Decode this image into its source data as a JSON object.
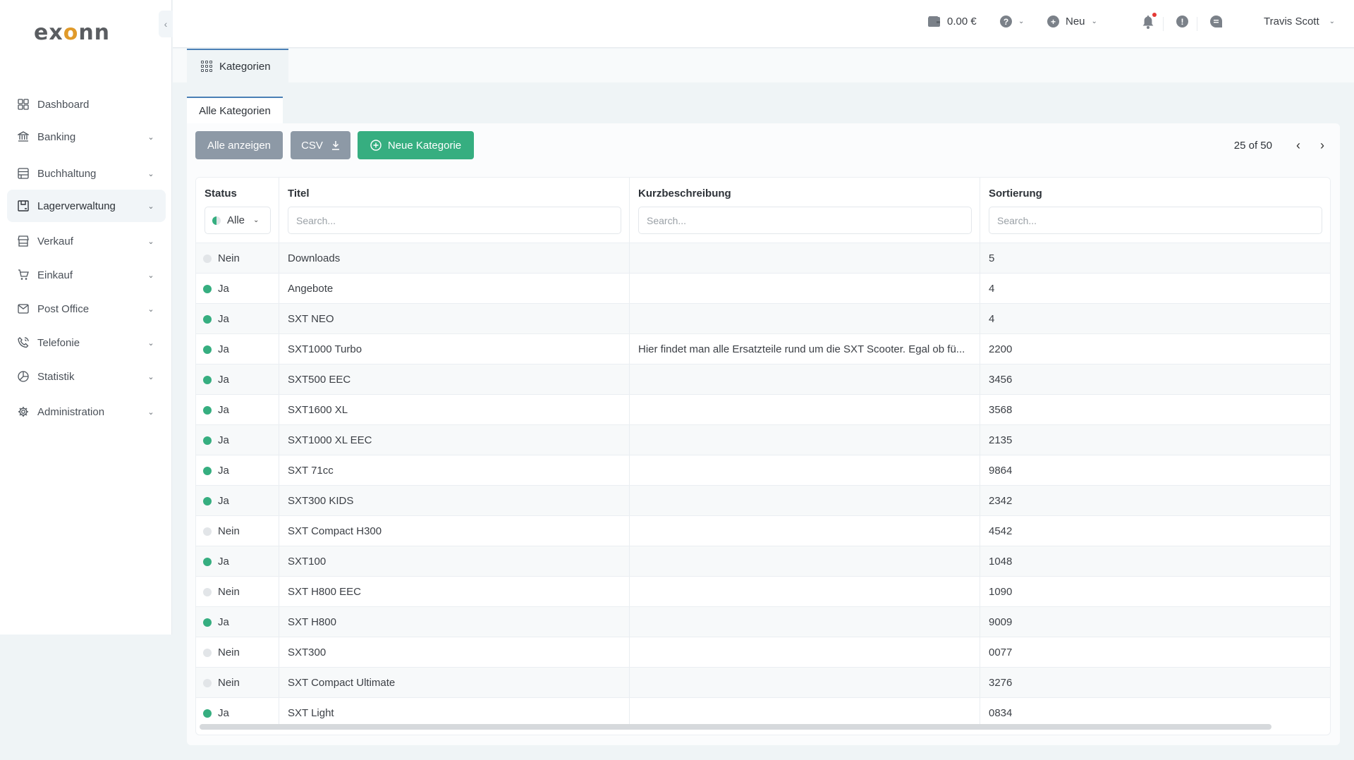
{
  "brand": {
    "name_prefix": "ex",
    "name_o": "o",
    "name_suffix": "nn"
  },
  "sidebar": {
    "collapse_icon": "‹",
    "items": [
      {
        "label": "Dashboard",
        "icon": "dashboard-grid-icon",
        "has_chevron": false,
        "active": false
      },
      {
        "label": "Banking",
        "icon": "bank-icon",
        "has_chevron": true,
        "active": false
      },
      {
        "label": "Buchhaltung",
        "icon": "ledger-icon",
        "has_chevron": true,
        "active": false
      },
      {
        "label": "Lagerverwaltung",
        "icon": "warehouse-box-icon",
        "has_chevron": true,
        "active": true
      },
      {
        "label": "Verkauf",
        "icon": "store-icon",
        "has_chevron": true,
        "active": false
      },
      {
        "label": "Einkauf",
        "icon": "cart-icon",
        "has_chevron": true,
        "active": false
      },
      {
        "label": "Post Office",
        "icon": "mail-icon",
        "has_chevron": true,
        "active": false
      },
      {
        "label": "Telefonie",
        "icon": "phone-icon",
        "has_chevron": true,
        "active": false
      },
      {
        "label": "Statistik",
        "icon": "pie-chart-icon",
        "has_chevron": true,
        "active": false
      },
      {
        "label": "Administration",
        "icon": "gear-icon",
        "has_chevron": true,
        "active": false
      }
    ]
  },
  "topbar": {
    "balance": "0.00 €",
    "help_icon": "?",
    "new_label": "Neu",
    "alert_icon": "!",
    "user_name": "Travis Scott",
    "notification_dot_color": "#e53935"
  },
  "page_tab": {
    "label": "Kategorien"
  },
  "sub_tab": {
    "label": "Alle Kategorien"
  },
  "toolbar": {
    "show_all_label": "Alle anzeigen",
    "csv_label": "CSV",
    "new_category_label": "Neue Kategorie",
    "accent_color": "#36ae80"
  },
  "pager": {
    "text": "25 of 50",
    "prev": "‹",
    "next": "›"
  },
  "table": {
    "columns": {
      "status": "Status",
      "title": "Titel",
      "description": "Kurzbeschreibung",
      "sort": "Sortierung"
    },
    "status_filter": "Alle",
    "search_placeholder": "Search...",
    "rows": [
      {
        "status": "Nein",
        "active": false,
        "title": "Downloads",
        "description": "",
        "sort": "5"
      },
      {
        "status": "Ja",
        "active": true,
        "title": "Angebote",
        "description": "",
        "sort": "4"
      },
      {
        "status": "Ja",
        "active": true,
        "title": "SXT NEO",
        "description": "",
        "sort": "4"
      },
      {
        "status": "Ja",
        "active": true,
        "title": "SXT1000 Turbo",
        "description": "Hier findet man alle Ersatzteile rund um die SXT Scooter. Egal ob fü...",
        "sort": "2200"
      },
      {
        "status": "Ja",
        "active": true,
        "title": "SXT500 EEC",
        "description": "",
        "sort": "3456"
      },
      {
        "status": "Ja",
        "active": true,
        "title": "SXT1600 XL",
        "description": "",
        "sort": "3568"
      },
      {
        "status": "Ja",
        "active": true,
        "title": "SXT1000 XL EEC",
        "description": "",
        "sort": "2135"
      },
      {
        "status": "Ja",
        "active": true,
        "title": "SXT 71cc",
        "description": "",
        "sort": "9864"
      },
      {
        "status": "Ja",
        "active": true,
        "title": "SXT300 KIDS",
        "description": "",
        "sort": "2342"
      },
      {
        "status": "Nein",
        "active": false,
        "title": "SXT Compact H300",
        "description": "",
        "sort": "4542"
      },
      {
        "status": "Ja",
        "active": true,
        "title": "SXT100",
        "description": "",
        "sort": "1048"
      },
      {
        "status": "Nein",
        "active": false,
        "title": "SXT H800 EEC",
        "description": "",
        "sort": "1090"
      },
      {
        "status": "Ja",
        "active": true,
        "title": "SXT H800",
        "description": "",
        "sort": "9009"
      },
      {
        "status": "Nein",
        "active": false,
        "title": "SXT300",
        "description": "",
        "sort": "0077"
      },
      {
        "status": "Nein",
        "active": false,
        "title": "SXT Compact Ultimate",
        "description": "",
        "sort": "3276"
      },
      {
        "status": "Ja",
        "active": true,
        "title": "SXT Light",
        "description": "",
        "sort": "0834"
      }
    ]
  }
}
